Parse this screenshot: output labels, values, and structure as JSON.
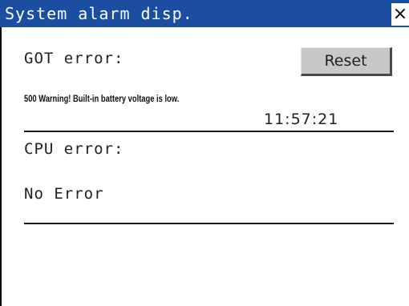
{
  "window": {
    "title": "System alarm disp.",
    "close_label": "×"
  },
  "got_error": {
    "label": "GOT error:",
    "reset_label": "Reset",
    "message": "500 Warning! Built-in battery voltage is low.",
    "time": "11:57:21"
  },
  "cpu_error": {
    "label": "CPU error:",
    "status": "No Error"
  },
  "colors": {
    "titlebar": "#1b4ea0",
    "button_face": "#c8c8c8"
  }
}
